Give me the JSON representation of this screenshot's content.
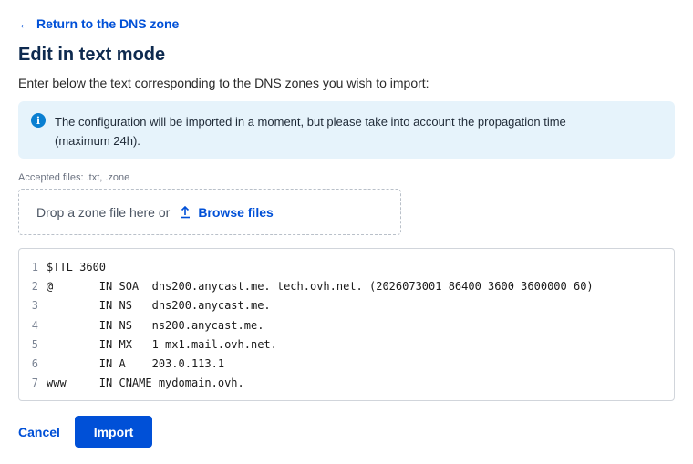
{
  "nav": {
    "back_label": "Return to the DNS zone"
  },
  "page": {
    "title": "Edit in text mode",
    "intro": "Enter below the text corresponding to the DNS zones you wish to import:"
  },
  "info": {
    "icon": "info-icon",
    "text_line1": "The configuration will be imported in a moment, but please take into account the propagation time",
    "text_line2": "(maximum 24h).",
    "accent": "#0a7fd1",
    "background": "#e6f3fb"
  },
  "upload": {
    "accepted_label": "Accepted files: .txt, .zone",
    "drop_text": "Drop a zone file here or",
    "browse_label": "Browse files"
  },
  "editor": {
    "lines": [
      {
        "num": "1",
        "text": "$TTL 3600"
      },
      {
        "num": "2",
        "text": "@       IN SOA  dns200.anycast.me. tech.ovh.net. (2026073001 86400 3600 3600000 60)"
      },
      {
        "num": "3",
        "text": "        IN NS   dns200.anycast.me."
      },
      {
        "num": "4",
        "text": "        IN NS   ns200.anycast.me."
      },
      {
        "num": "5",
        "text": "        IN MX   1 mx1.mail.ovh.net."
      },
      {
        "num": "6",
        "text": "        IN A    203.0.113.1"
      },
      {
        "num": "7",
        "text": "www     IN CNAME mydomain.ovh."
      }
    ]
  },
  "actions": {
    "cancel_label": "Cancel",
    "import_label": "Import"
  },
  "colors": {
    "primary": "#0050d7",
    "title": "#0e2a4f"
  }
}
